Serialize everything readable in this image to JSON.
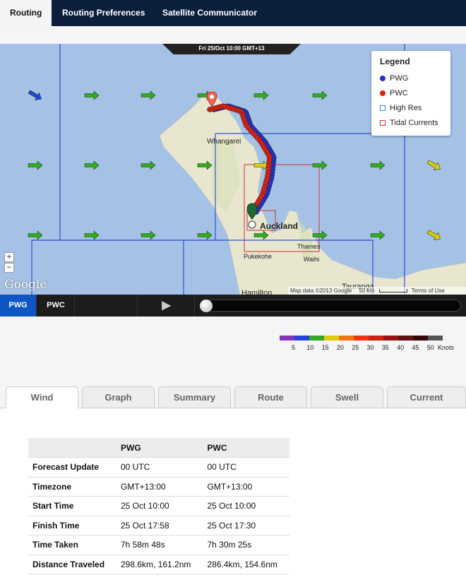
{
  "nav": {
    "tabs": [
      "Routing",
      "Routing Preferences",
      "Satellite Communicator"
    ],
    "active": 0
  },
  "map": {
    "datetime": "Fri 25/Oct 10:00 GMT+13",
    "legend": {
      "title": "Legend",
      "items": [
        {
          "label": "PWG",
          "color": "#2233cc",
          "shape": "dot"
        },
        {
          "label": "PWC",
          "color": "#dd2211",
          "shape": "dot"
        },
        {
          "label": "High Res",
          "color": "#3388dd",
          "shape": "square"
        },
        {
          "label": "Tidal Currents",
          "color": "#cc3333",
          "shape": "square"
        }
      ]
    },
    "places": [
      "Whangarei",
      "Auckland",
      "Thames",
      "Pukekohe",
      "Waihi",
      "Tauranga",
      "Hamilton"
    ],
    "zoom_in": "+",
    "zoom_out": "−",
    "google_logo": "Google",
    "attribution": "Map data ©2013 Google",
    "scale": "50 km",
    "terms": "Terms of Use"
  },
  "player": {
    "routes": [
      "PWG",
      "PWC"
    ],
    "active": "PWG",
    "play_icon": "play-icon"
  },
  "wind_scale": {
    "colors": [
      "#8833bb",
      "#2244dd",
      "#33aa22",
      "#ddcc11",
      "#ee7711",
      "#ee3311",
      "#cc2211",
      "#991111",
      "#661111",
      "#330808",
      "#555555"
    ],
    "labels": [
      "5",
      "10",
      "15",
      "20",
      "25",
      "30",
      "35",
      "40",
      "45",
      "50"
    ],
    "unit": "Knots"
  },
  "tabs": [
    "Wind",
    "Graph",
    "Summary",
    "Route",
    "Swell",
    "Current"
  ],
  "active_tab": "Wind",
  "table": {
    "headers": [
      "",
      "PWG",
      "PWC"
    ],
    "rows": [
      [
        "Forecast Update",
        "00 UTC",
        "00 UTC"
      ],
      [
        "Timezone",
        "GMT+13:00",
        "GMT+13:00"
      ],
      [
        "Start Time",
        "25 Oct 10:00",
        "25 Oct 10:00"
      ],
      [
        "Finish Time",
        "25 Oct 17:58",
        "25 Oct 17:30"
      ],
      [
        "Time Taken",
        "7h 58m 48s",
        "7h 30m 25s"
      ],
      [
        "Distance Traveled",
        "298.6km, 161.2nm",
        "286.4km, 154.6nm"
      ]
    ]
  }
}
